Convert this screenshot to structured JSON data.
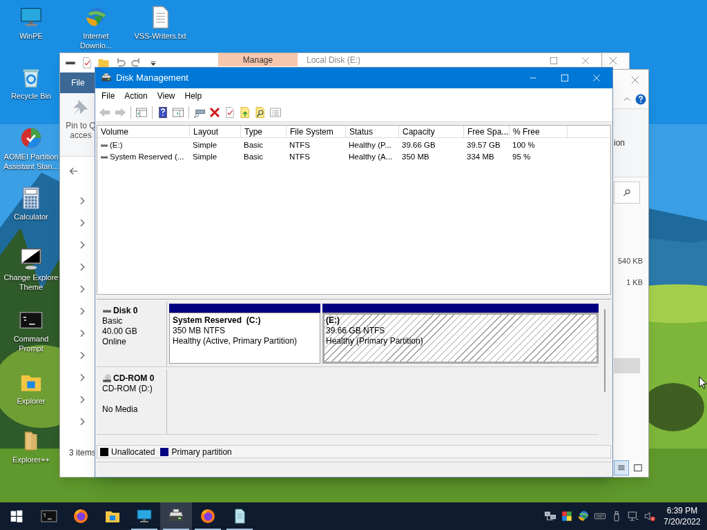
{
  "desktop": {
    "icons": [
      {
        "kind": "monitor",
        "lines": [
          "WinPE"
        ]
      },
      {
        "kind": "globe",
        "lines": [
          "Internet",
          "Downlo..."
        ]
      },
      {
        "kind": "textfile",
        "lines": [
          "VSS-Writers.txt"
        ]
      },
      {
        "kind": "recycle",
        "lines": [
          "Recycle Bin"
        ]
      },
      {
        "kind": "pie",
        "lines": [
          "AOMEI Partition",
          "Assistant Stan..."
        ]
      },
      {
        "kind": "calculator",
        "lines": [
          "Calculator"
        ]
      },
      {
        "kind": "theme",
        "lines": [
          "Change Explore",
          "Theme"
        ]
      },
      {
        "kind": "console",
        "lines": [
          "Command",
          "Prompt"
        ]
      },
      {
        "kind": "folder",
        "lines": [
          "Explorer"
        ]
      },
      {
        "kind": "folderpp",
        "lines": [
          "Explorer++"
        ]
      }
    ]
  },
  "explorer_window": {
    "context_tab": "Manage",
    "title": "Local Disk (E:)",
    "ribbon_tab": "File",
    "pin_lines": [
      "Pin to Q",
      "acces"
    ],
    "status": "3 items"
  },
  "explorer_window_2": {
    "ribbon_text": "ion",
    "sizes": [
      "540 KB",
      "1 KB"
    ]
  },
  "disk_management": {
    "title": "Disk Management",
    "menu": [
      "File",
      "Action",
      "View",
      "Help"
    ],
    "toolbar": [
      {
        "buttons": [
          {
            "kind": "back",
            "disabled": true
          },
          {
            "kind": "forward",
            "disabled": true
          }
        ]
      },
      {
        "buttons": [
          {
            "kind": "tree",
            "disabled": false
          }
        ]
      },
      {
        "buttons": [
          {
            "kind": "help",
            "disabled": false
          },
          {
            "kind": "panel",
            "disabled": false
          }
        ]
      },
      {
        "buttons": [
          {
            "kind": "connect",
            "disabled": false
          },
          {
            "kind": "delete",
            "disabled": false
          },
          {
            "kind": "check",
            "disabled": false
          },
          {
            "kind": "folder_up",
            "disabled": false
          },
          {
            "kind": "folder_search",
            "disabled": false
          },
          {
            "kind": "list",
            "disabled": false
          }
        ]
      }
    ],
    "volume_list": {
      "columns": [
        "Volume",
        "Layout",
        "Type",
        "File System",
        "Status",
        "Capacity",
        "Free Spa...",
        "% Free"
      ],
      "rows": [
        {
          "cells": [
            "(E:)",
            "Simple",
            "Basic",
            "NTFS",
            "Healthy (P...",
            "39.66 GB",
            "39.57 GB",
            "100 %"
          ]
        },
        {
          "cells": [
            "System Reserved (...",
            "Simple",
            "Basic",
            "NTFS",
            "Healthy (A...",
            "350 MB",
            "334 MB",
            "95 %"
          ]
        }
      ]
    },
    "disks": [
      {
        "kind": "disk",
        "name": "Disk 0",
        "type": "Basic",
        "size": "40.00 GB",
        "status": "Online",
        "partitions": [
          {
            "name": "System Reserved  (C:)",
            "size": "350 MB NTFS",
            "health": "Healthy (Active, Primary Partition)",
            "selected": false
          },
          {
            "name": "(E:)",
            "size": "39.66 GB NTFS",
            "health": "Healthy (Primary Partition)",
            "selected": true
          }
        ]
      },
      {
        "kind": "cdrom",
        "name": "CD-ROM 0",
        "type": "CD-ROM (D:)",
        "status": "No Media"
      }
    ],
    "legend": [
      {
        "label": "Unallocated",
        "color": "#000000"
      },
      {
        "label": "Primary partition",
        "color": "#000080"
      }
    ]
  },
  "taskbar": {
    "apps": [
      {
        "kind": "console",
        "running": false,
        "selected": false
      },
      {
        "kind": "firefox",
        "running": false,
        "selected": false
      },
      {
        "kind": "folder",
        "running": false,
        "selected": false
      },
      {
        "kind": "monitor",
        "running": true,
        "selected": false
      },
      {
        "kind": "diskmgmt",
        "running": true,
        "selected": true
      },
      {
        "kind": "firefox",
        "running": true,
        "selected": false
      },
      {
        "kind": "document",
        "running": true,
        "selected": false
      }
    ],
    "tray": [
      {
        "kind": "network"
      },
      {
        "kind": "colors"
      },
      {
        "kind": "globe"
      },
      {
        "kind": "keyboard"
      },
      {
        "kind": "usb"
      },
      {
        "kind": "netmonitor"
      },
      {
        "kind": "volume_muted"
      }
    ],
    "clock": {
      "time": "6:39 PM",
      "date": "7/20/2022"
    }
  }
}
